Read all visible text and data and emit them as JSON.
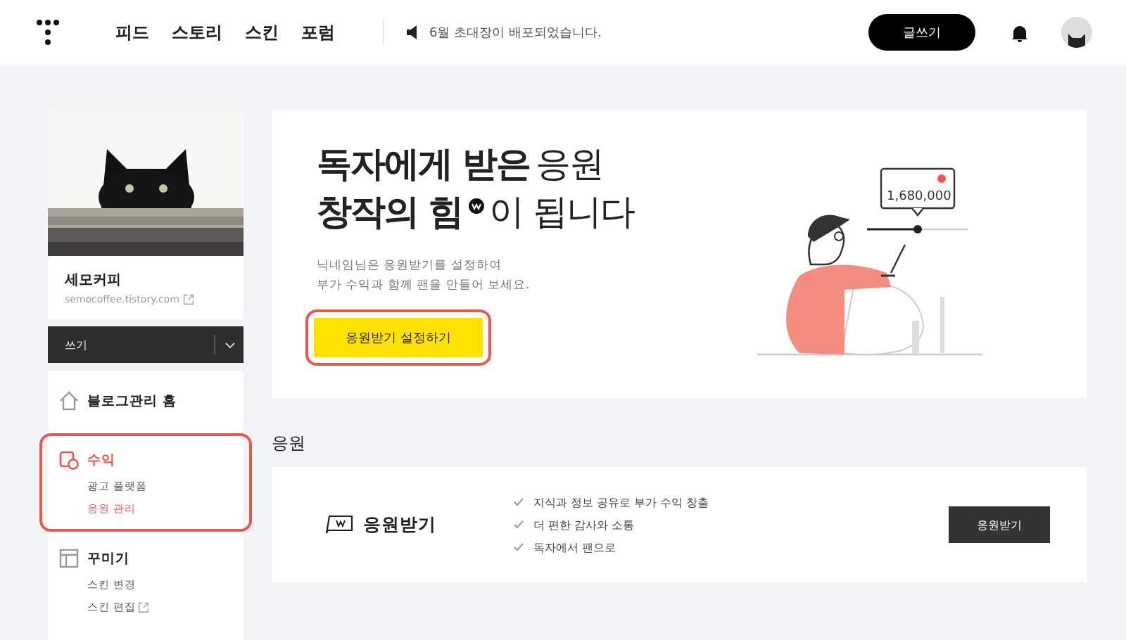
{
  "header": {
    "nav": [
      {
        "label": "피드"
      },
      {
        "label": "스토리"
      },
      {
        "label": "스킨"
      },
      {
        "label": "포럼"
      }
    ],
    "notice": "6월 초대장이 배포되었습니다.",
    "write_button": "글쓰기"
  },
  "sidebar": {
    "blog": {
      "name": "세모커피",
      "url": "semocoffee.tistory.com"
    },
    "write_button": "쓰기",
    "menu": [
      {
        "kind": "home",
        "label": "블로그관리 홈",
        "selected": false,
        "highlighted": false
      },
      {
        "kind": "revenue",
        "label": "수익",
        "selected": true,
        "highlighted": true,
        "children": [
          {
            "label": "광고 플랫폼",
            "selected": false,
            "external": false
          },
          {
            "label": "응원 관리",
            "selected": true,
            "external": false
          }
        ]
      },
      {
        "kind": "design",
        "label": "꾸미기",
        "selected": false,
        "highlighted": false,
        "children": [
          {
            "label": "스킨 변경",
            "selected": false,
            "external": false
          },
          {
            "label": "스킨 편집",
            "selected": false,
            "external": true
          }
        ]
      }
    ]
  },
  "hero": {
    "title_line1": "**독자에게 받은** 응원",
    "title_line2_bold": "창작의 힘",
    "title_line2_rest": "이 됩니다",
    "description": [
      "닉네임님은 응원받기를 설정하여",
      "부가 수익과 함께 팬을 만들어 보세요."
    ],
    "button": {
      "label": "응원받기 설정하기",
      "highlighted": true
    },
    "illustration_amount": "1,680,000"
  },
  "section": {
    "title": "응원",
    "card": {
      "name": "응원받기",
      "benefits": [
        "지식과 정보 공유로 부가 수익 창출",
        "더 편한 감사와 소통",
        "독자에서 팬으로"
      ],
      "button": "응원받기"
    }
  }
}
